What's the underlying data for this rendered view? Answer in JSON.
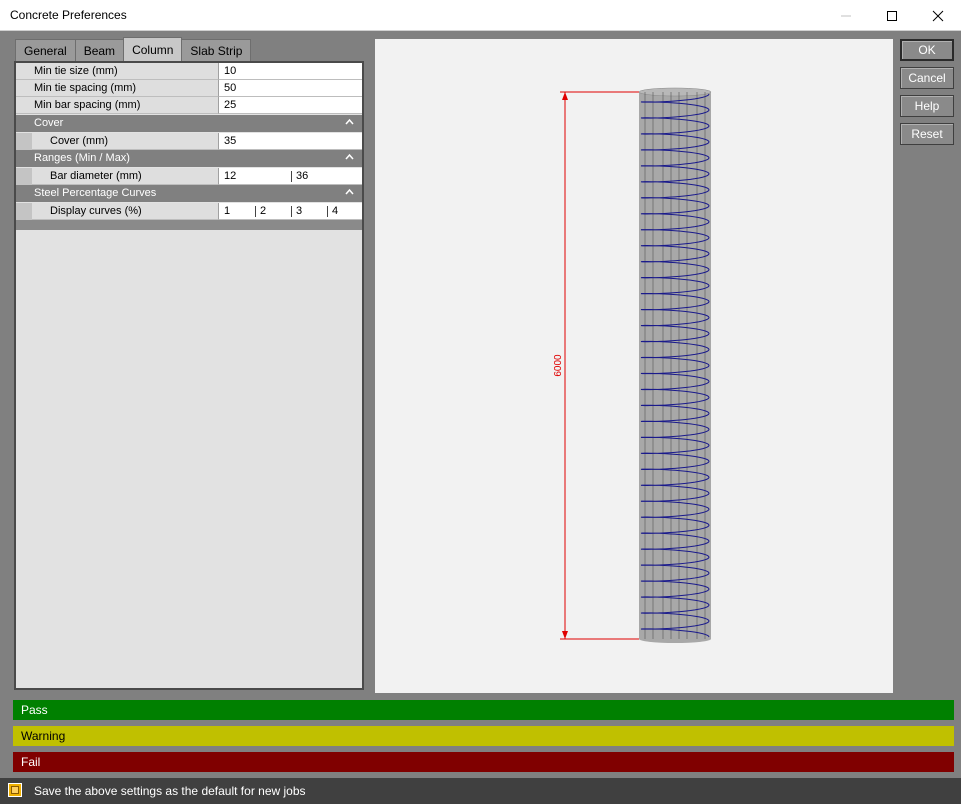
{
  "window": {
    "title": "Concrete Preferences"
  },
  "tabs": [
    {
      "label": "General"
    },
    {
      "label": "Beam"
    },
    {
      "label": "Column"
    },
    {
      "label": "Slab Strip"
    }
  ],
  "grid": {
    "rows": {
      "min_tie_size": {
        "label": "Min tie size (mm)",
        "value": "10"
      },
      "min_tie_spacing": {
        "label": "Min tie spacing (mm)",
        "value": "50"
      },
      "min_bar_spacing": {
        "label": "Min bar spacing (mm)",
        "value": "25"
      }
    },
    "categories": {
      "cover": {
        "title": "Cover",
        "rows": {
          "cover": {
            "label": "Cover (mm)",
            "value": "35"
          }
        }
      },
      "ranges": {
        "title": "Ranges (Min / Max)",
        "rows": {
          "bar_diameter": {
            "label": "Bar diameter (mm)",
            "min": "12",
            "max": "36"
          }
        }
      },
      "curves": {
        "title": "Steel Percentage Curves",
        "rows": {
          "display_curves": {
            "label": "Display curves (%)",
            "values": [
              "1",
              "2",
              "3",
              "4"
            ]
          }
        }
      }
    }
  },
  "preview": {
    "dimension_label": "6000",
    "colors": {
      "dimension": "#e00000",
      "spiral": "#1a1a8c",
      "column": "#a8a8a8"
    }
  },
  "buttons": {
    "ok": "OK",
    "cancel": "Cancel",
    "help": "Help",
    "reset": "Reset"
  },
  "legend": {
    "pass": {
      "label": "Pass",
      "color": "#008000"
    },
    "warning": {
      "label": "Warning",
      "color": "#c0c000"
    },
    "fail": {
      "label": "Fail",
      "color": "#800000"
    }
  },
  "footer": {
    "checkbox_label": "Save the above settings as the default for new jobs",
    "checked": true
  }
}
